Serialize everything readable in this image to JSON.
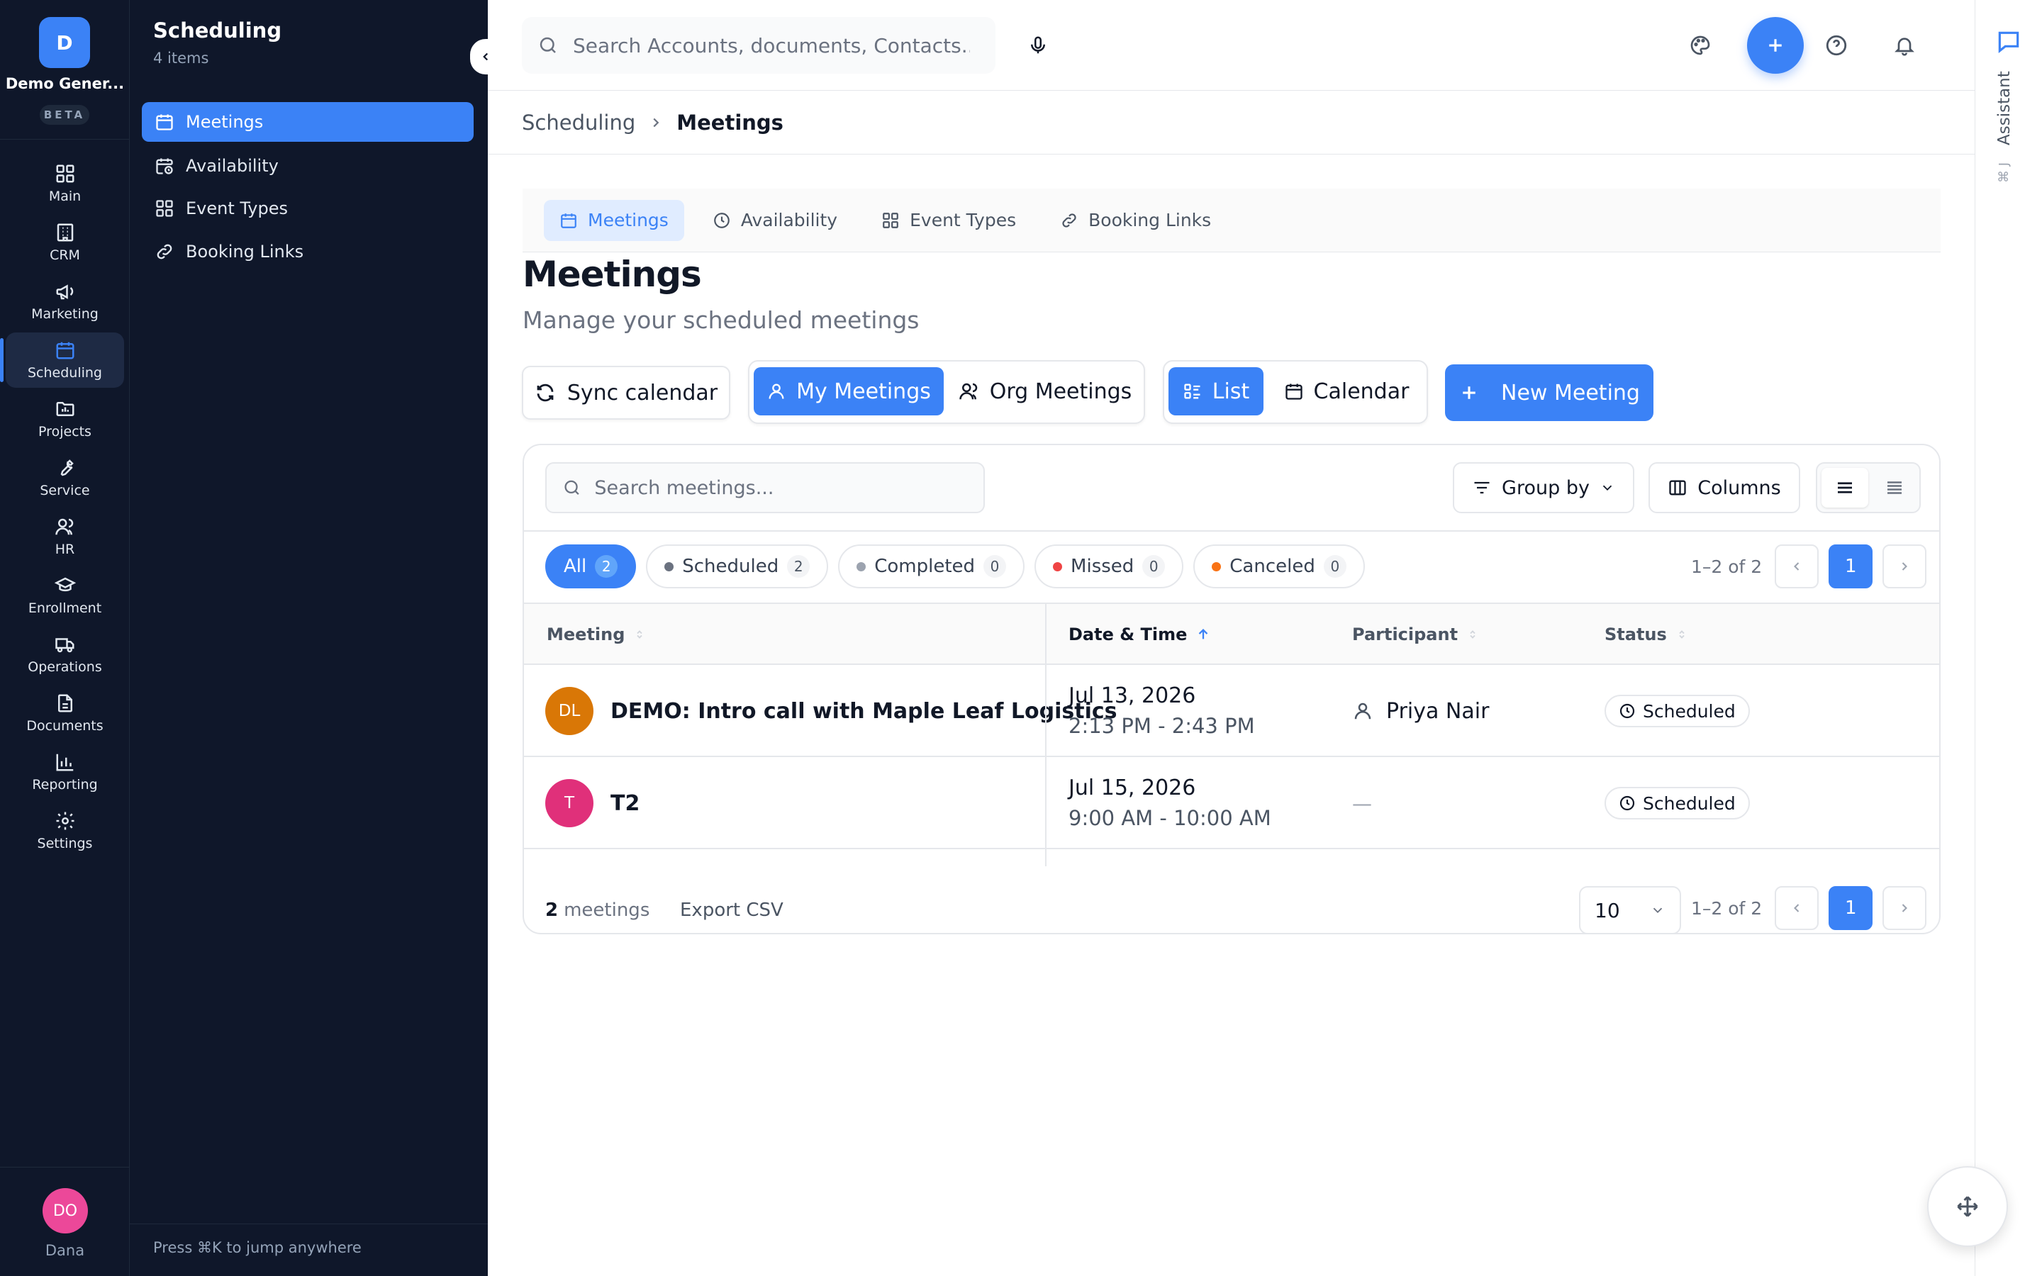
{
  "workspace": {
    "initial": "D",
    "name": "Demo Gener...",
    "badge": "BETA"
  },
  "rail": {
    "items": [
      {
        "label": "Main",
        "icon": "grid-icon"
      },
      {
        "label": "CRM",
        "icon": "building-icon"
      },
      {
        "label": "Marketing",
        "icon": "megaphone-icon"
      },
      {
        "label": "Scheduling",
        "icon": "calendar-icon"
      },
      {
        "label": "Projects",
        "icon": "folder-chart-icon"
      },
      {
        "label": "Service",
        "icon": "wrench-icon"
      },
      {
        "label": "HR",
        "icon": "users-icon"
      },
      {
        "label": "Enrollment",
        "icon": "graduation-cap-icon"
      },
      {
        "label": "Operations",
        "icon": "truck-icon"
      },
      {
        "label": "Documents",
        "icon": "file-text-icon"
      },
      {
        "label": "Reporting",
        "icon": "bar-chart-icon"
      },
      {
        "label": "Settings",
        "icon": "gear-icon"
      }
    ],
    "active": "Scheduling",
    "user": {
      "initials": "DO",
      "name": "Dana"
    }
  },
  "subnav": {
    "title": "Scheduling",
    "count": "4 items",
    "items": [
      {
        "label": "Meetings",
        "icon": "calendar-icon"
      },
      {
        "label": "Availability",
        "icon": "calendar-clock-icon"
      },
      {
        "label": "Event Types",
        "icon": "grid-icon"
      },
      {
        "label": "Booking Links",
        "icon": "link-icon"
      }
    ],
    "footer": "Press ⌘K to jump anywhere"
  },
  "topbar": {
    "search_placeholder": "Search Accounts, documents, Contacts..."
  },
  "breadcrumb": {
    "parent": "Scheduling",
    "current": "Meetings"
  },
  "tabs": [
    {
      "label": "Meetings",
      "icon": "calendar-icon"
    },
    {
      "label": "Availability",
      "icon": "clock-icon"
    },
    {
      "label": "Event Types",
      "icon": "grid-icon"
    },
    {
      "label": "Booking Links",
      "icon": "link-icon"
    }
  ],
  "page": {
    "title": "Meetings",
    "subtitle": "Manage your scheduled meetings"
  },
  "actions": {
    "sync": "Sync calendar",
    "my_meetings": "My Meetings",
    "org_meetings": "Org Meetings",
    "list": "List",
    "calendar": "Calendar",
    "new_meeting": "New Meeting"
  },
  "table": {
    "search_placeholder": "Search meetings...",
    "group_by": "Group by",
    "columns_btn": "Columns",
    "filters": [
      {
        "label": "All",
        "count": "2",
        "color": ""
      },
      {
        "label": "Scheduled",
        "count": "2",
        "color": "#6b7280"
      },
      {
        "label": "Completed",
        "count": "0",
        "color": "#9ca3af"
      },
      {
        "label": "Missed",
        "count": "0",
        "color": "#ef4444"
      },
      {
        "label": "Canceled",
        "count": "0",
        "color": "#f97316"
      }
    ],
    "range": "1–2 of 2",
    "page": "1",
    "headers": {
      "meeting": "Meeting",
      "datetime": "Date & Time",
      "participant": "Participant",
      "status": "Status"
    },
    "rows": [
      {
        "initials": "DL",
        "avatar_color": "#d97706",
        "title": "DEMO: Intro call with Maple Leaf Logistics",
        "date": "Jul 13, 2026",
        "time": "2:13 PM - 2:43 PM",
        "participant": "Priya Nair",
        "status": "Scheduled"
      },
      {
        "initials": "T",
        "avatar_color": "#e0307a",
        "title": "T2",
        "date": "Jul 15, 2026",
        "time": "9:00 AM - 10:00 AM",
        "participant": "—",
        "status": "Scheduled"
      }
    ],
    "footer": {
      "count": "2",
      "count_label": "meetings",
      "export": "Export CSV",
      "page_size": "10",
      "range": "1–2 of 2",
      "page": "1"
    }
  },
  "assistant": {
    "label": "Assistant",
    "shortcut": "⌘ J"
  }
}
